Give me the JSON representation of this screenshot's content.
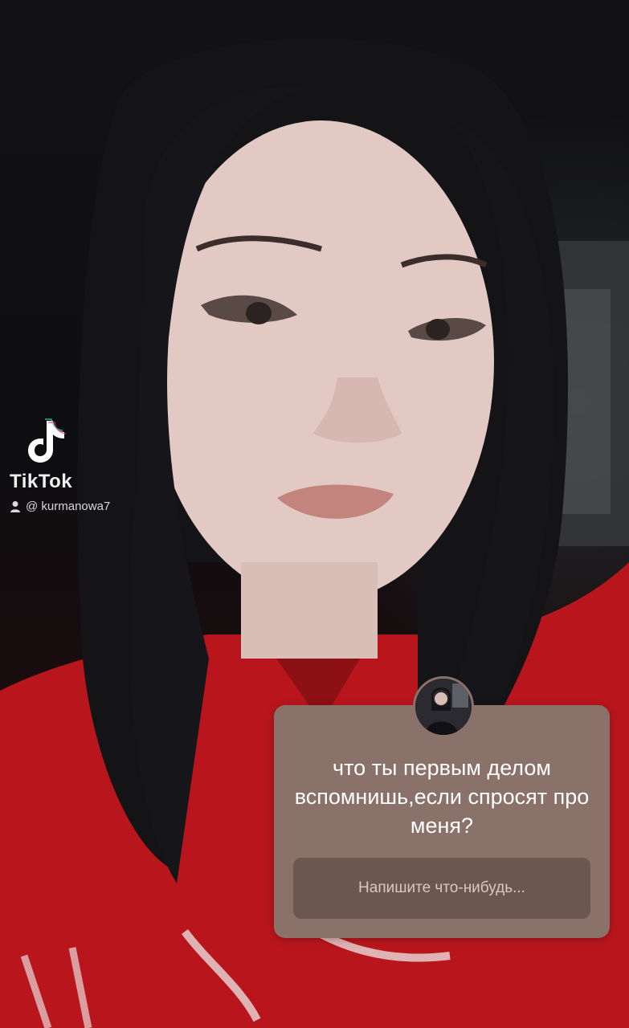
{
  "watermark": {
    "brand": "TikTok",
    "username": "@ kurmanowa7",
    "logo_icon": "tiktok-logo-icon",
    "user_icon": "person-icon"
  },
  "question_sticker": {
    "question": "что ты первым делом вспомнишь,если спросят про меня?",
    "input_placeholder": "Напишите что-нибудь...",
    "card_color": "#8a716a",
    "input_color": "#6b5750"
  },
  "colors": {
    "background_dark": "#0e0e10",
    "hoodie_red": "#c41a1f"
  }
}
